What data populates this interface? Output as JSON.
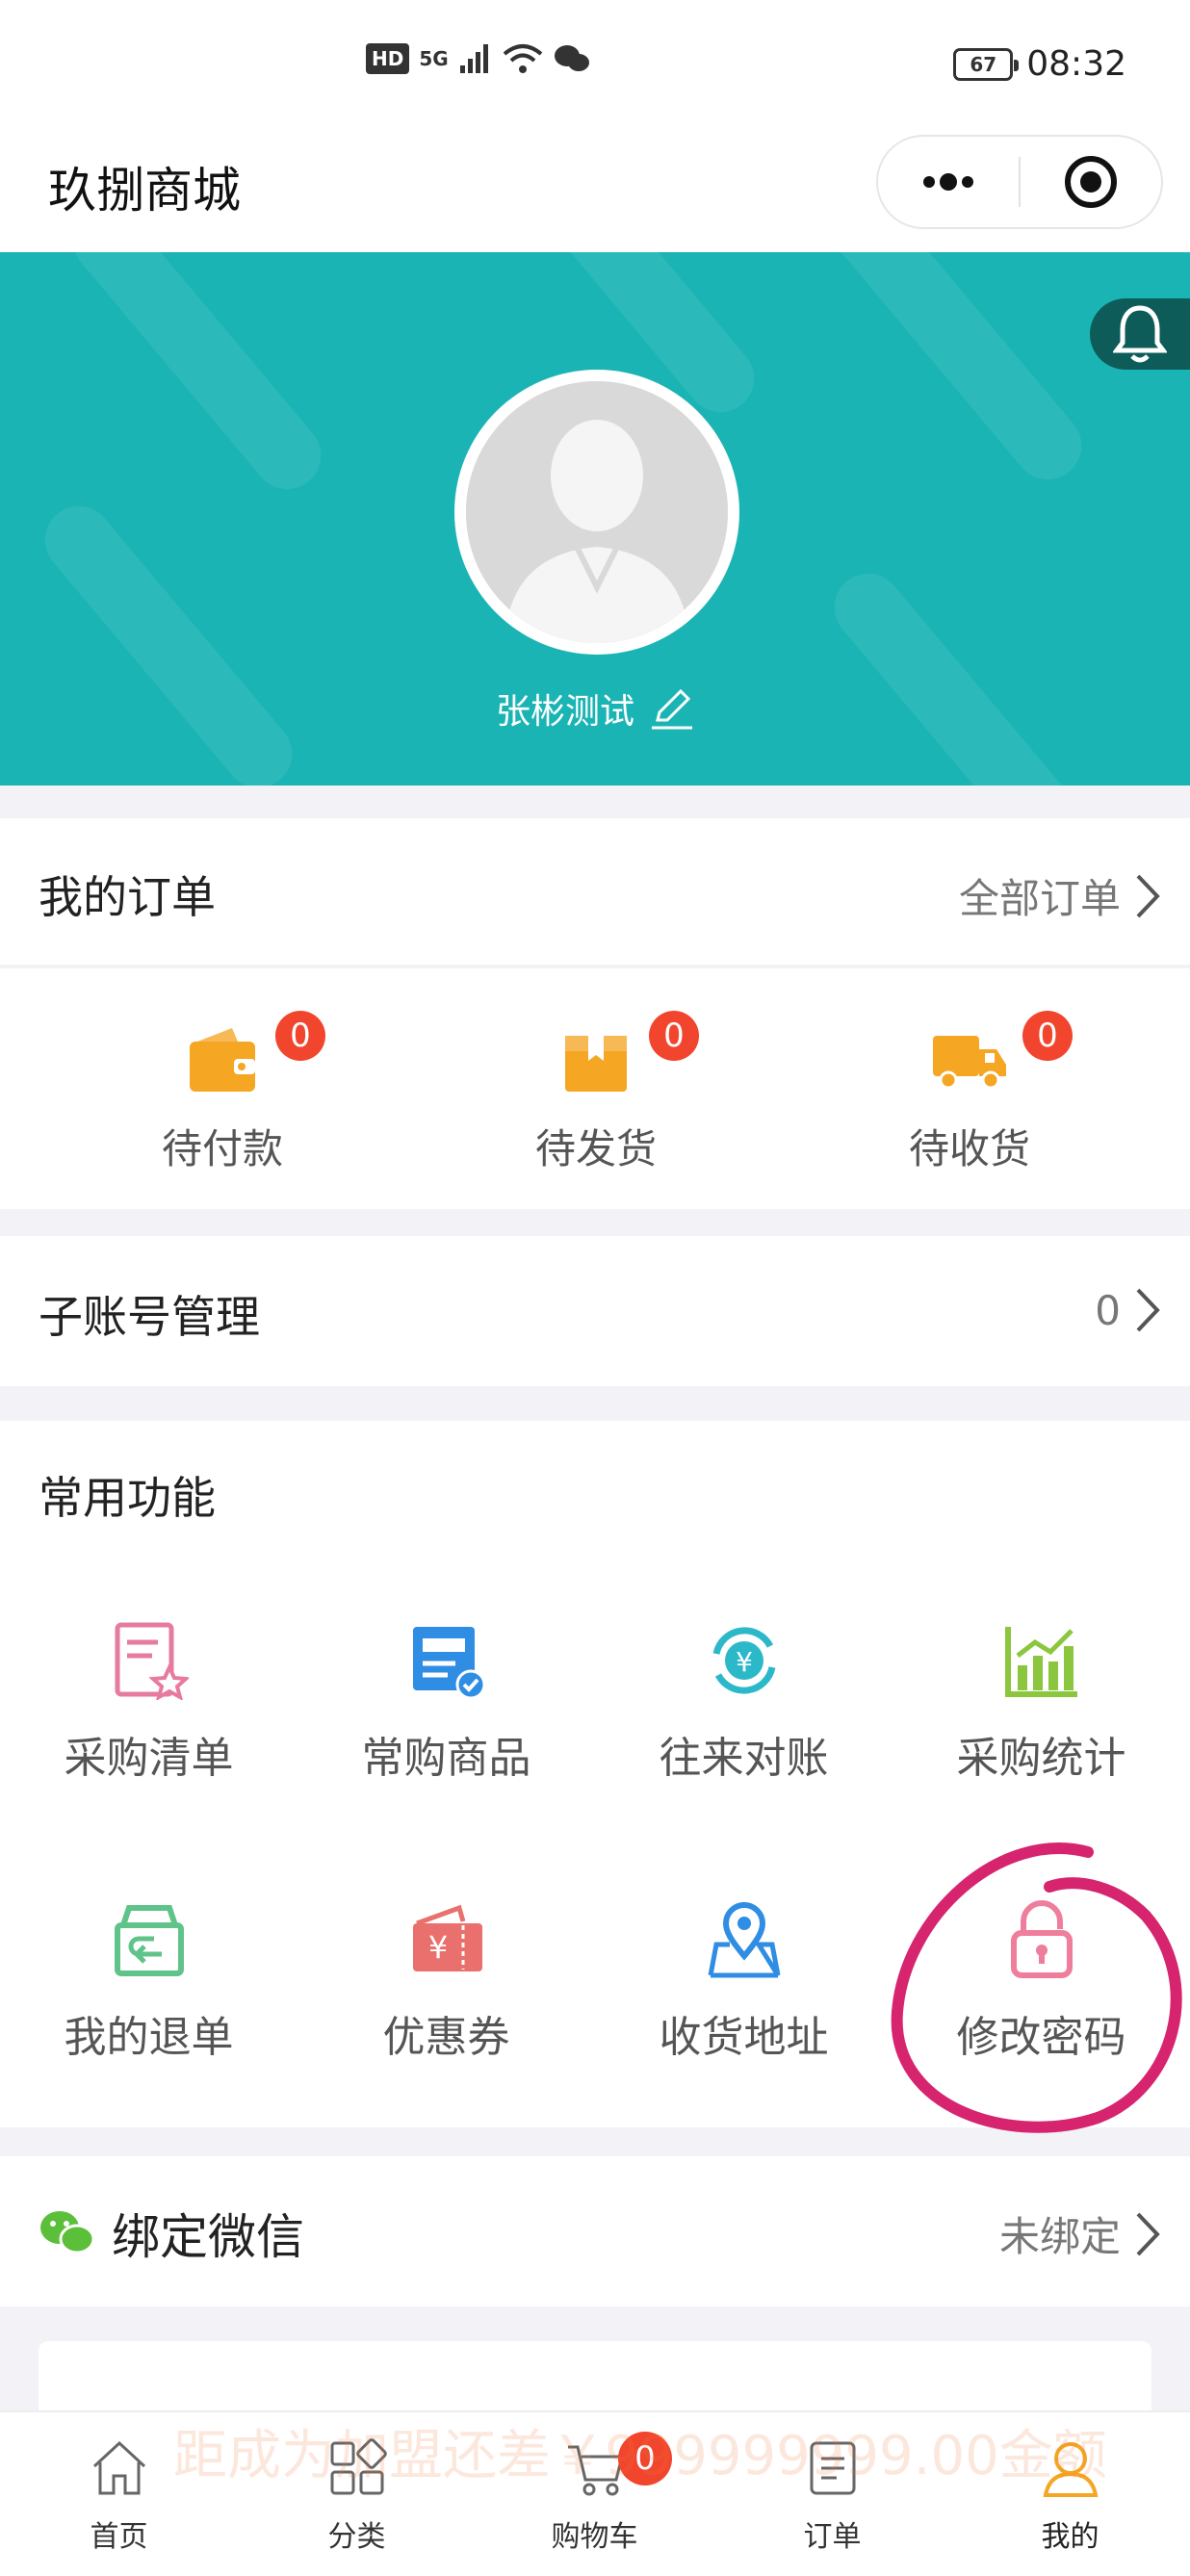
{
  "status_bar": {
    "hd": "HD",
    "network": "5G",
    "battery": "67",
    "time": "08:32"
  },
  "nav": {
    "title": "玖捌商城"
  },
  "profile": {
    "username": "张彬测试"
  },
  "orders": {
    "title": "我的订单",
    "all_label": "全部订单",
    "items": [
      {
        "label": "待付款",
        "count": "0",
        "icon": "wallet-icon"
      },
      {
        "label": "待发货",
        "count": "0",
        "icon": "box-icon"
      },
      {
        "label": "待收货",
        "count": "0",
        "icon": "truck-icon"
      }
    ]
  },
  "sub_accounts": {
    "title": "子账号管理",
    "count": "0"
  },
  "functions": {
    "title": "常用功能",
    "items": [
      {
        "label": "采购清单",
        "icon": "purchase-list-icon"
      },
      {
        "label": "常购商品",
        "icon": "frequent-goods-icon"
      },
      {
        "label": "往来对账",
        "icon": "reconciliation-icon"
      },
      {
        "label": "采购统计",
        "icon": "statistics-icon"
      },
      {
        "label": "我的退单",
        "icon": "return-icon"
      },
      {
        "label": "优惠券",
        "icon": "coupon-icon"
      },
      {
        "label": "收货地址",
        "icon": "address-icon"
      },
      {
        "label": "修改密码",
        "icon": "lock-icon"
      }
    ]
  },
  "wechat": {
    "title": "绑定微信",
    "status": "未绑定"
  },
  "banner_hint": "距成为加盟还差￥999999999.00金额",
  "cart_badge": "0",
  "tabs": [
    {
      "label": "首页",
      "icon": "home-icon"
    },
    {
      "label": "分类",
      "icon": "category-icon"
    },
    {
      "label": "购物车",
      "icon": "cart-icon"
    },
    {
      "label": "订单",
      "icon": "orders-icon"
    },
    {
      "label": "我的",
      "icon": "user-icon"
    }
  ],
  "colors": {
    "teal": "#1bb4b4",
    "orange": "#f5a623",
    "badge_red": "#f2452d",
    "active_tab": "#f5a623",
    "annotation": "#d6246e"
  }
}
